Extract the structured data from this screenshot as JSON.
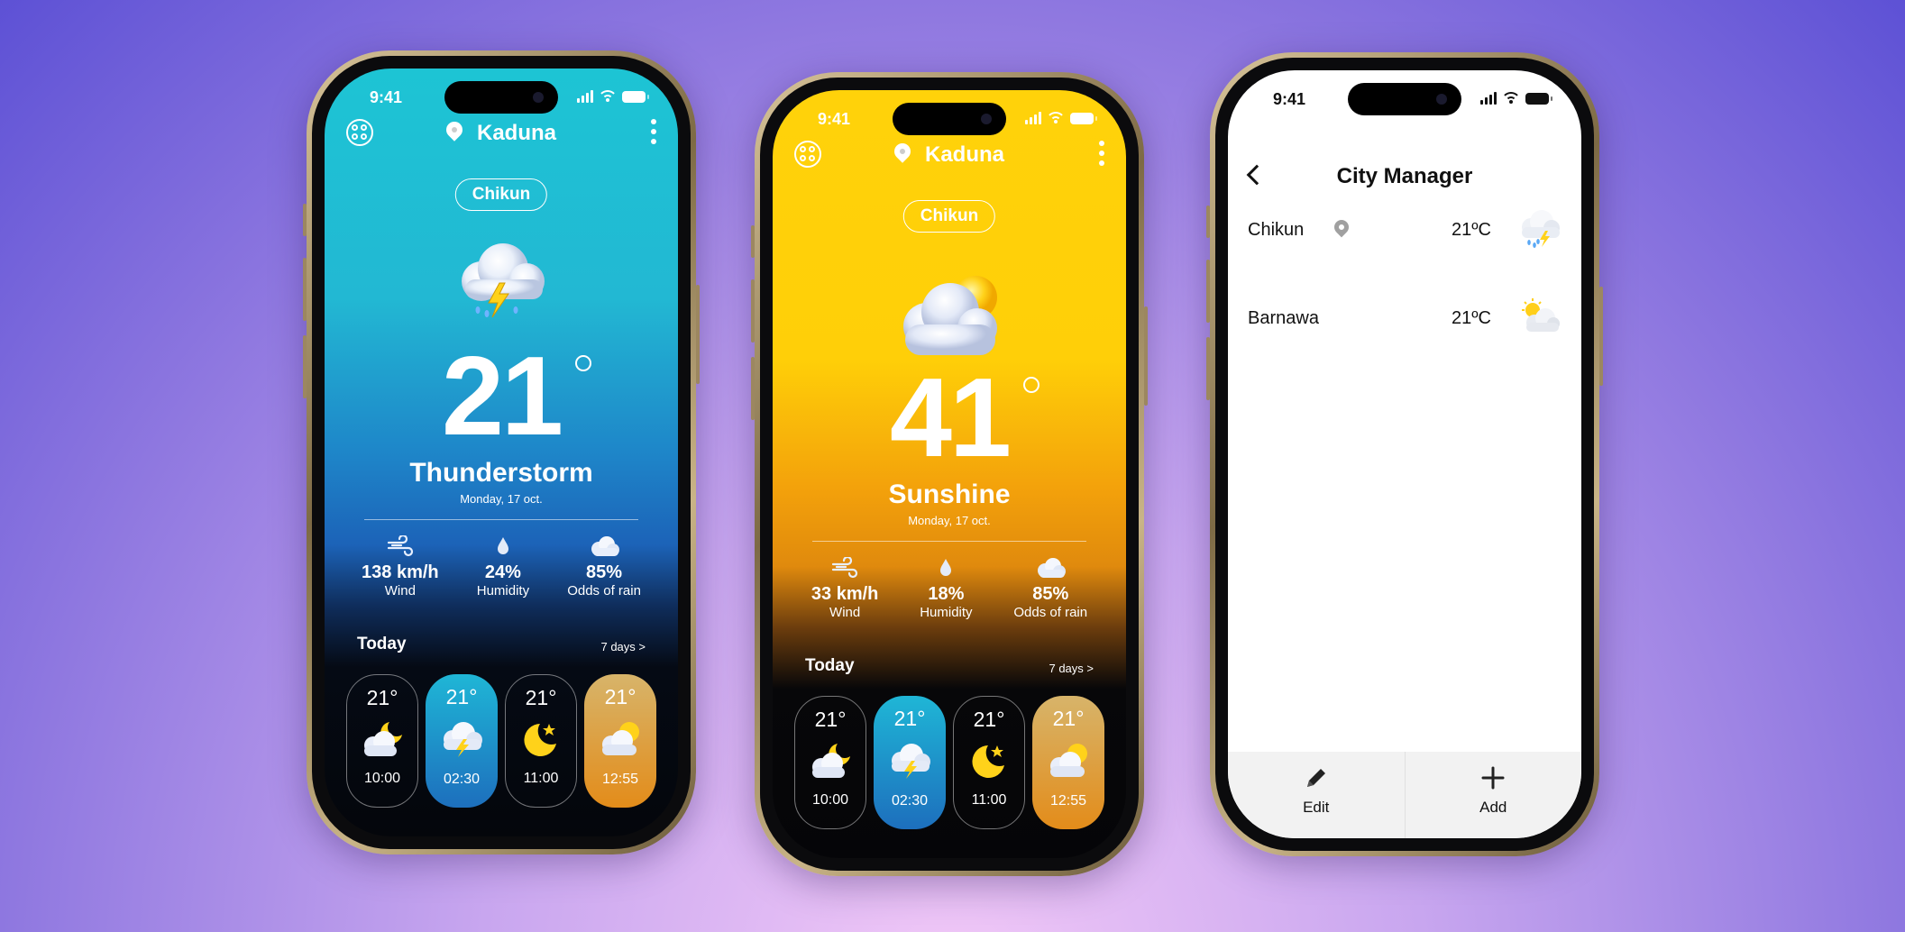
{
  "status_time": "9:41",
  "phones": [
    {
      "id": "thunder",
      "city": "Kaduna",
      "district": "Chikun",
      "temperature": "21",
      "condition": "Thunderstorm",
      "date": "Monday, 17 oct.",
      "stats": [
        {
          "icon": "wind-icon",
          "value": "138 km/h",
          "label": "Wind"
        },
        {
          "icon": "humidity-drop-icon",
          "value": "24%",
          "label": "Humidity"
        },
        {
          "icon": "cloud-icon",
          "value": "85%",
          "label": "Odds of rain"
        }
      ],
      "today_label": "Today",
      "seven_days_label": "7 days >",
      "hourly": [
        {
          "temp": "21°",
          "time": "10:00",
          "icon": "cloud-moon-icon",
          "style": "outline"
        },
        {
          "temp": "21°",
          "time": "02:30",
          "icon": "thunder-cloud-icon",
          "style": "blue"
        },
        {
          "temp": "21°",
          "time": "11:00",
          "icon": "moon-star-icon",
          "style": "outline"
        },
        {
          "temp": "21°",
          "time": "12:55",
          "icon": "sun-cloud-icon",
          "style": "gold"
        }
      ]
    },
    {
      "id": "sunshine",
      "city": "Kaduna",
      "district": "Chikun",
      "temperature": "41",
      "condition": "Sunshine",
      "date": "Monday, 17 oct.",
      "stats": [
        {
          "icon": "wind-icon",
          "value": "33 km/h",
          "label": "Wind"
        },
        {
          "icon": "humidity-drop-icon",
          "value": "18%",
          "label": "Humidity"
        },
        {
          "icon": "cloud-icon",
          "value": "85%",
          "label": "Odds of rain"
        }
      ],
      "today_label": "Today",
      "seven_days_label": "7 days >",
      "hourly": [
        {
          "temp": "21°",
          "time": "10:00",
          "icon": "cloud-moon-icon",
          "style": "outline"
        },
        {
          "temp": "21°",
          "time": "02:30",
          "icon": "thunder-cloud-icon",
          "style": "blue"
        },
        {
          "temp": "21°",
          "time": "11:00",
          "icon": "moon-star-icon",
          "style": "outline"
        },
        {
          "temp": "21°",
          "time": "12:55",
          "icon": "sun-cloud-icon",
          "style": "gold"
        }
      ]
    }
  ],
  "city_manager": {
    "title": "City Manager",
    "cities": [
      {
        "name": "Chikun",
        "temp": "21ºC",
        "icon": "rain-thunder-cloud-icon",
        "current": true
      },
      {
        "name": "Barnawa",
        "temp": "21ºC",
        "icon": "sun-cloud-icon",
        "current": false
      }
    ],
    "actions": [
      {
        "label": "Edit",
        "icon": "pencil-icon"
      },
      {
        "label": "Add",
        "icon": "plus-icon"
      }
    ]
  },
  "colors": {
    "background_top": "#5d51d5",
    "background_bottom": "#f1c8f7",
    "thunder_screen": "#1dc4d4",
    "sunshine_screen": "#ffd20a",
    "blue_card": "#1d6fbd",
    "gold_card": "#e38c1a"
  }
}
